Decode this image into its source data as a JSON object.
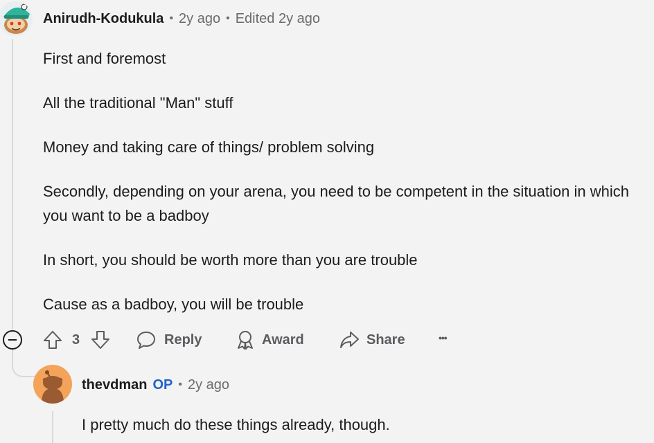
{
  "comment": {
    "author": "Anirudh-Kodukula",
    "age": "2y ago",
    "edited": "Edited 2y ago",
    "paragraphs": [
      "First and foremost",
      "All the traditional \"Man\" stuff",
      "Money and taking care of things/ problem solving",
      "Secondly, depending on your arena, you need to be competent in the situation in which you want to be a badboy",
      "In short, you should be worth more than you are trouble",
      "Cause as a badboy, you will be trouble"
    ],
    "actions": {
      "score": "3",
      "reply_label": "Reply",
      "award_label": "Award",
      "share_label": "Share",
      "more_label": "•••"
    },
    "avatar_icon": "snoo-avatar-teal-hat"
  },
  "reply": {
    "author": "thevdman",
    "op_badge": "OP",
    "age": "2y ago",
    "text": "I pretty much do these things already, though.",
    "avatar_icon": "snoo-avatar-orange"
  },
  "colors": {
    "background": "#f3f3f3",
    "op_blue": "#1f62d1",
    "muted": "#6a6c6f",
    "avatar_orange": "#f4a35a"
  }
}
